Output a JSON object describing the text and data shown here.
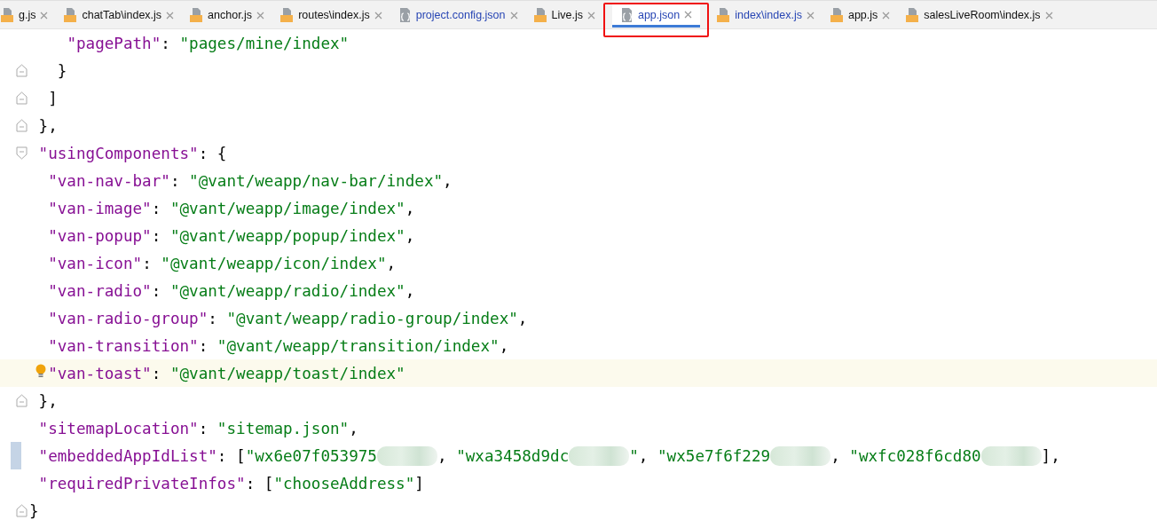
{
  "tabs": [
    {
      "label": "g.js",
      "kind": "js",
      "selected": false,
      "modified": false
    },
    {
      "label": "chatTab\\index.js",
      "kind": "js",
      "selected": false,
      "modified": false
    },
    {
      "label": "anchor.js",
      "kind": "js",
      "selected": false,
      "modified": false
    },
    {
      "label": "routes\\index.js",
      "kind": "js",
      "selected": false,
      "modified": false
    },
    {
      "label": "project.config.json",
      "kind": "json",
      "selected": false,
      "modified": true
    },
    {
      "label": "Live.js",
      "kind": "js",
      "selected": false,
      "modified": false
    },
    {
      "label": "app.json",
      "kind": "json",
      "selected": true,
      "modified": true
    },
    {
      "label": "index\\index.js",
      "kind": "js",
      "selected": false,
      "modified": true
    },
    {
      "label": "app.js",
      "kind": "js",
      "selected": false,
      "modified": false
    },
    {
      "label": "salesLiveRoom\\index.js",
      "kind": "js",
      "selected": false,
      "modified": false
    }
  ],
  "editor": {
    "lines": [
      {
        "fold_start": false,
        "fold_end": false,
        "current": false,
        "changed": false,
        "tokens": [
          {
            "kind": "key",
            "text": "    \"pagePath\""
          },
          {
            "kind": "punct",
            "text": ": "
          },
          {
            "kind": "str",
            "text": "\"pages/mine/index\""
          }
        ]
      },
      {
        "fold_start": false,
        "fold_end": true,
        "current": false,
        "changed": false,
        "tokens": [
          {
            "kind": "punct",
            "text": "   }"
          }
        ]
      },
      {
        "fold_start": false,
        "fold_end": true,
        "current": false,
        "changed": false,
        "tokens": [
          {
            "kind": "punct",
            "text": "  ]"
          }
        ]
      },
      {
        "fold_start": false,
        "fold_end": true,
        "current": false,
        "changed": false,
        "tokens": [
          {
            "kind": "punct",
            "text": " },"
          }
        ]
      },
      {
        "fold_start": true,
        "fold_end": false,
        "current": false,
        "changed": false,
        "tokens": [
          {
            "kind": "key",
            "text": " \"usingComponents\""
          },
          {
            "kind": "punct",
            "text": ": {"
          }
        ]
      },
      {
        "fold_start": false,
        "fold_end": false,
        "current": false,
        "changed": false,
        "tokens": [
          {
            "kind": "key",
            "text": "  \"van-nav-bar\""
          },
          {
            "kind": "punct",
            "text": ": "
          },
          {
            "kind": "str",
            "text": "\"@vant/weapp/nav-bar/index\""
          },
          {
            "kind": "punct",
            "text": ","
          }
        ]
      },
      {
        "fold_start": false,
        "fold_end": false,
        "current": false,
        "changed": false,
        "tokens": [
          {
            "kind": "key",
            "text": "  \"van-image\""
          },
          {
            "kind": "punct",
            "text": ": "
          },
          {
            "kind": "str",
            "text": "\"@vant/weapp/image/index\""
          },
          {
            "kind": "punct",
            "text": ","
          }
        ]
      },
      {
        "fold_start": false,
        "fold_end": false,
        "current": false,
        "changed": false,
        "tokens": [
          {
            "kind": "key",
            "text": "  \"van-popup\""
          },
          {
            "kind": "punct",
            "text": ": "
          },
          {
            "kind": "str",
            "text": "\"@vant/weapp/popup/index\""
          },
          {
            "kind": "punct",
            "text": ","
          }
        ]
      },
      {
        "fold_start": false,
        "fold_end": false,
        "current": false,
        "changed": false,
        "tokens": [
          {
            "kind": "key",
            "text": "  \"van-icon\""
          },
          {
            "kind": "punct",
            "text": ": "
          },
          {
            "kind": "str",
            "text": "\"@vant/weapp/icon/index\""
          },
          {
            "kind": "punct",
            "text": ","
          }
        ]
      },
      {
        "fold_start": false,
        "fold_end": false,
        "current": false,
        "changed": false,
        "tokens": [
          {
            "kind": "key",
            "text": "  \"van-radio\""
          },
          {
            "kind": "punct",
            "text": ": "
          },
          {
            "kind": "str",
            "text": "\"@vant/weapp/radio/index\""
          },
          {
            "kind": "punct",
            "text": ","
          }
        ]
      },
      {
        "fold_start": false,
        "fold_end": false,
        "current": false,
        "changed": false,
        "tokens": [
          {
            "kind": "key",
            "text": "  \"van-radio-group\""
          },
          {
            "kind": "punct",
            "text": ": "
          },
          {
            "kind": "str",
            "text": "\"@vant/weapp/radio-group/index\""
          },
          {
            "kind": "punct",
            "text": ","
          }
        ]
      },
      {
        "fold_start": false,
        "fold_end": false,
        "current": false,
        "changed": false,
        "tokens": [
          {
            "kind": "key",
            "text": "  \"van-transition\""
          },
          {
            "kind": "punct",
            "text": ": "
          },
          {
            "kind": "str",
            "text": "\"@vant/weapp/transition/index\""
          },
          {
            "kind": "punct",
            "text": ","
          }
        ]
      },
      {
        "fold_start": false,
        "fold_end": false,
        "current": true,
        "changed": false,
        "tokens": [
          {
            "kind": "key",
            "text": "  \"van-toast\""
          },
          {
            "kind": "punct",
            "text": ": "
          },
          {
            "kind": "str",
            "text": "\"@vant/weapp/toast/index\""
          }
        ]
      },
      {
        "fold_start": false,
        "fold_end": true,
        "current": false,
        "changed": false,
        "tokens": [
          {
            "kind": "punct",
            "text": " },"
          }
        ]
      },
      {
        "fold_start": false,
        "fold_end": false,
        "current": false,
        "changed": false,
        "tokens": [
          {
            "kind": "key",
            "text": " \"sitemapLocation\""
          },
          {
            "kind": "punct",
            "text": ": "
          },
          {
            "kind": "str",
            "text": "\"sitemap.json\""
          },
          {
            "kind": "punct",
            "text": ","
          }
        ]
      },
      {
        "fold_start": false,
        "fold_end": false,
        "current": false,
        "changed": true,
        "tokens": [
          {
            "kind": "key",
            "text": " \"embeddedAppIdList\""
          },
          {
            "kind": "punct",
            "text": ": ["
          },
          {
            "kind": "str",
            "text": "\"wx6e07f053975"
          },
          {
            "kind": "mask"
          },
          {
            "kind": "punct",
            "text": ", "
          },
          {
            "kind": "str",
            "text": "\"wxa3458d9dc"
          },
          {
            "kind": "mask"
          },
          {
            "kind": "str",
            "text": "\""
          },
          {
            "kind": "punct",
            "text": ", "
          },
          {
            "kind": "str",
            "text": "\"wx5e7f6f229"
          },
          {
            "kind": "mask"
          },
          {
            "kind": "punct",
            "text": ", "
          },
          {
            "kind": "str",
            "text": "\"wxfc028f6cd80"
          },
          {
            "kind": "mask"
          },
          {
            "kind": "punct",
            "text": "],"
          }
        ]
      },
      {
        "fold_start": false,
        "fold_end": false,
        "current": false,
        "changed": false,
        "tokens": [
          {
            "kind": "key",
            "text": " \"requiredPrivateInfos\""
          },
          {
            "kind": "punct",
            "text": ": ["
          },
          {
            "kind": "str",
            "text": "\"chooseAddress\""
          },
          {
            "kind": "punct",
            "text": "]"
          }
        ]
      },
      {
        "fold_start": false,
        "fold_end": true,
        "current": false,
        "changed": false,
        "tokens": [
          {
            "kind": "punct",
            "text": "}"
          }
        ]
      }
    ]
  }
}
